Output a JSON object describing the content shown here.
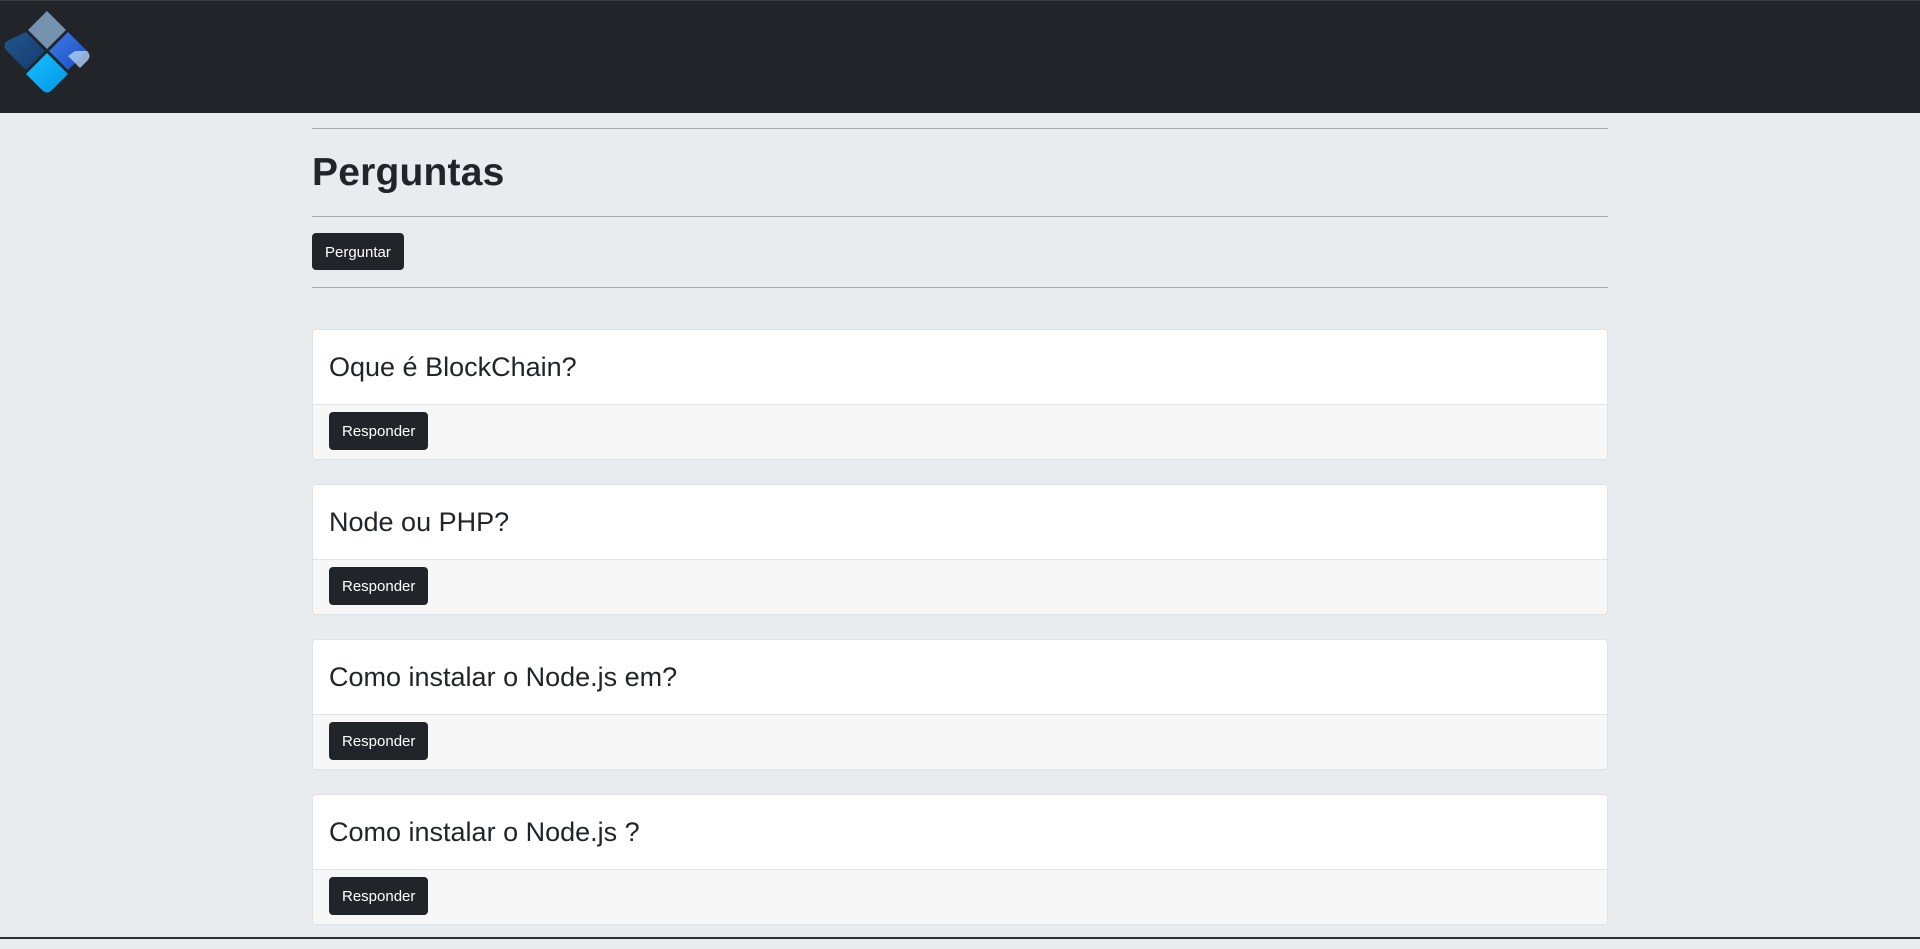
{
  "colors": {
    "navbar_bg": "#212529",
    "page_bg": "#e9ecef",
    "button_bg": "#212529",
    "button_text": "#ffffff",
    "card_bg": "#ffffff",
    "card_footer_bg": "#f7f7f7",
    "logo_primary": "#00a8f0",
    "logo_secondary": "#1e5fd6"
  },
  "navbar": {
    "logo_icon": "blockchain-diamond-logo"
  },
  "main": {
    "title": "Perguntas",
    "ask_button_label": "Perguntar"
  },
  "questions": [
    {
      "title": "Oque é BlockChain?",
      "answer_button_label": "Responder"
    },
    {
      "title": "Node ou PHP?",
      "answer_button_label": "Responder"
    },
    {
      "title": "Como instalar o Node.js em?",
      "answer_button_label": "Responder"
    },
    {
      "title": "Como instalar o Node.js ?",
      "answer_button_label": "Responder"
    }
  ]
}
